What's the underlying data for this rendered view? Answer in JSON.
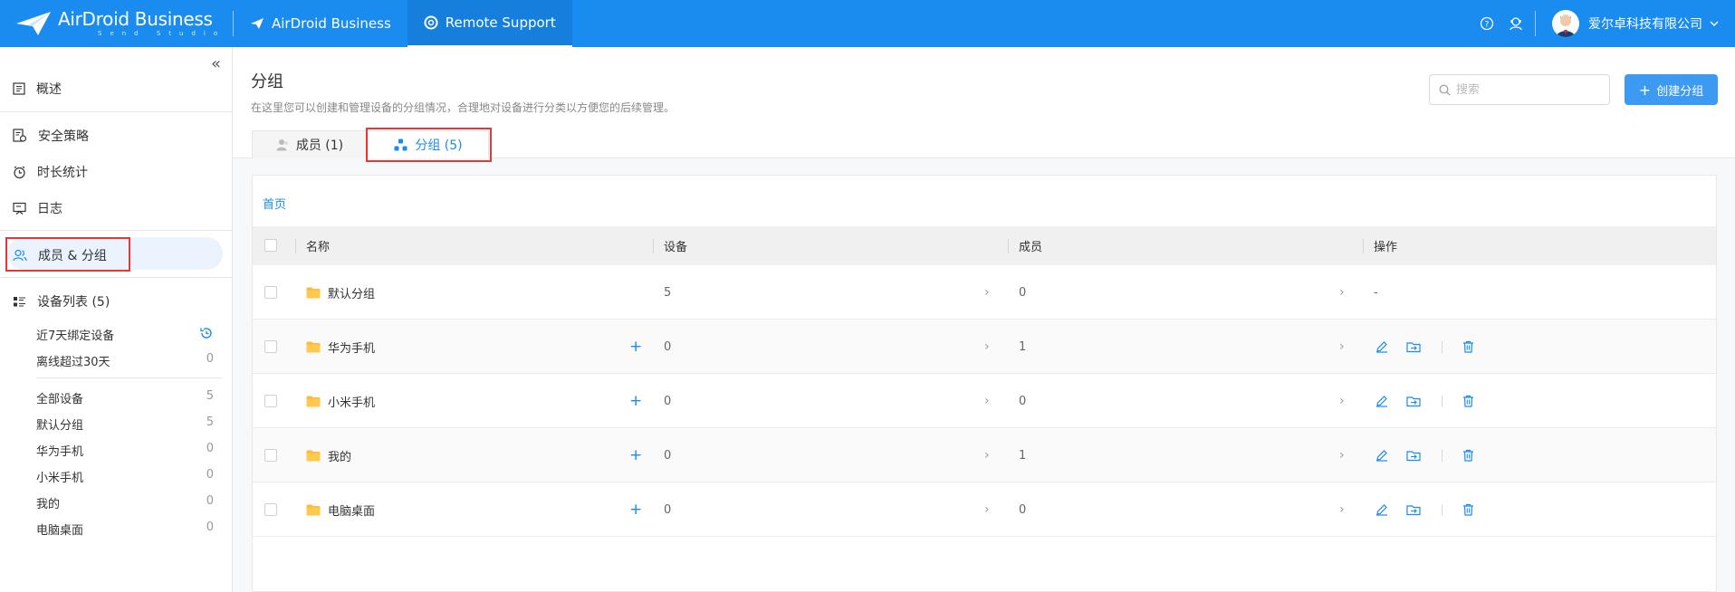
{
  "brand": {
    "name": "AirDroid Business",
    "sub": "Send Studio"
  },
  "nav": {
    "tab1": "AirDroid Business",
    "tab2": "Remote Support"
  },
  "user": {
    "company": "爱尔卓科技有限公司"
  },
  "sidebar": {
    "items": [
      {
        "label": "概述",
        "icon": "document-icon"
      },
      {
        "label": "安全策略",
        "icon": "policy-icon"
      },
      {
        "label": "时长统计",
        "icon": "clock-icon"
      },
      {
        "label": "日志",
        "icon": "log-icon"
      },
      {
        "label": "成员 & 分组",
        "icon": "users-icon"
      },
      {
        "label": "设备列表 (5)",
        "icon": "list-icon"
      }
    ],
    "sub1": [
      {
        "label": "近7天绑定设备"
      },
      {
        "label": "离线超过30天",
        "count": "0"
      }
    ],
    "sub2": [
      {
        "label": "全部设备",
        "count": "5"
      },
      {
        "label": "默认分组",
        "count": "5"
      },
      {
        "label": "华为手机",
        "count": "0"
      },
      {
        "label": "小米手机",
        "count": "0"
      },
      {
        "label": "我的",
        "count": "0"
      },
      {
        "label": "电脑桌面",
        "count": "0"
      }
    ]
  },
  "main": {
    "title": "分组",
    "desc": "在这里您可以创建和管理设备的分组情况，合理地对设备进行分类以方便您的后续管理。",
    "search_placeholder": "搜索",
    "create_label": "创建分组",
    "tabs": [
      {
        "label": "成员 (1)"
      },
      {
        "label": "分组 (5)"
      }
    ],
    "breadcrumb": "首页",
    "columns": [
      "名称",
      "设备",
      "成员",
      "操作"
    ],
    "rows": [
      {
        "name": "默认分组",
        "devices": "5",
        "members": "0",
        "ops": "-"
      },
      {
        "name": "华为手机",
        "devices": "0",
        "members": "1"
      },
      {
        "name": "小米手机",
        "devices": "0",
        "members": "0"
      },
      {
        "name": "我的",
        "devices": "0",
        "members": "1"
      },
      {
        "name": "电脑桌面",
        "devices": "0",
        "members": "0"
      }
    ]
  },
  "colors": {
    "brand": "#1a8cf0",
    "highlight": "#e53935"
  }
}
